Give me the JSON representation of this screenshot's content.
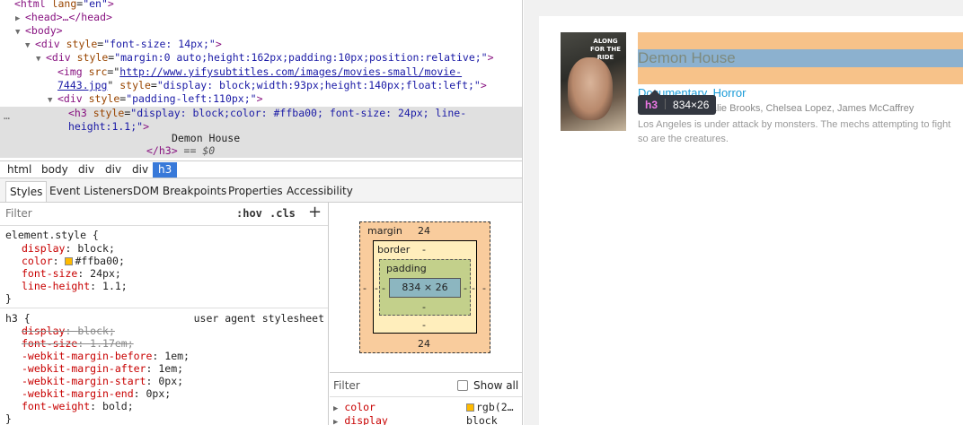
{
  "dom_tree": {
    "line1_tag": "<html",
    "line1_attr": " lang",
    "line1_val": "\"en\"",
    "line1_end": ">",
    "line2": "<head>…</head>",
    "line3": "<body>",
    "line4_tag": "<div",
    "line4_attr": " style",
    "line4_val": "\"font-size: 14px;\"",
    "line5_tag": "<div",
    "line5_attr": " style",
    "line5_val": "\"margin:0 auto;height:162px;padding:10px;position:relative;\"",
    "line6_tag": "<img",
    "line6_attr": " src",
    "line6_link": "http://www.yifysubtitles.com/images/movies-small/movie-",
    "line7_link": "7443.jpg",
    "line7_attr": " style",
    "line7_val": "\"display: block;width:93px;height:140px;float:left;\"",
    "line8_tag": "<div",
    "line8_attr": " style",
    "line8_val": "\"padding-left:110px;\"",
    "line9_tag": "<h3",
    "line9_attr": " style",
    "line9_val": "\"display: block;color: #ffba00; font-size: 24px; line-",
    "line10_val": "height:1.1;\"",
    "line11_text": "Demon House",
    "line12_close": "</h3>",
    "line12_eq": " == $0",
    "ellipsis": "…"
  },
  "breadcrumbs": [
    "html",
    "body",
    "div",
    "div",
    "div",
    "h3"
  ],
  "subtabs": [
    "Styles",
    "Event Listeners",
    "DOM Breakpoints",
    "Properties",
    "Accessibility"
  ],
  "styles": {
    "filter_placeholder": "Filter",
    "hov": ":hov",
    "cls": ".cls",
    "plus": "+",
    "element_style_selector": "element.style {",
    "element_props": [
      {
        "name": "display",
        "value": "block;"
      },
      {
        "name": "color",
        "value": "#ffba00;"
      },
      {
        "name": "font-size",
        "value": "24px;"
      },
      {
        "name": "line-height",
        "value": "1.1;"
      }
    ],
    "close_brace": "}",
    "ua_selector": "h3 {",
    "ua_source": "user agent stylesheet",
    "ua_props": [
      {
        "name": "display",
        "value": "block;",
        "struck": true
      },
      {
        "name": "font-size",
        "value": "1.17em;",
        "struck": true
      },
      {
        "name": "-webkit-margin-before",
        "value": "1em;"
      },
      {
        "name": "-webkit-margin-after",
        "value": "1em;"
      },
      {
        "name": "-webkit-margin-start",
        "value": "0px;"
      },
      {
        "name": "-webkit-margin-end",
        "value": "0px;"
      },
      {
        "name": "font-weight",
        "value": "bold;"
      }
    ],
    "swatch_color": "#ffba00"
  },
  "box_model": {
    "margin_label": "margin",
    "margin_top": "24",
    "margin_bottom": "24",
    "margin_left": "-",
    "margin_right": "-",
    "border_label": "border",
    "border_top": "-",
    "border_bottom": "-",
    "border_left": "-",
    "border_right": "-",
    "padding_label": "padding",
    "padding_top": "-",
    "padding_bottom": "-",
    "padding_left": "-",
    "padding_right": "-",
    "content": "834 × 26"
  },
  "computed": {
    "filter_placeholder": "Filter",
    "show_all": "Show all",
    "rows": [
      {
        "name": "color",
        "value": "rgb(2…"
      },
      {
        "name": "display",
        "value": "block"
      }
    ]
  },
  "preview": {
    "poster_title": "ALONG FOR THE RIDE",
    "movie_title": "Demon House",
    "genre": "Documentary, Horror",
    "cast": "Zak Bagans, Natalie Brooks, Chelsea Lopez, James McCaffrey",
    "synopsis_1": "Los Angeles is under attack by monsters. The mechs attempting to fight",
    "synopsis_2": "so are the creatures.",
    "tooltip_tag": "h3",
    "tooltip_dims": "834×26"
  }
}
